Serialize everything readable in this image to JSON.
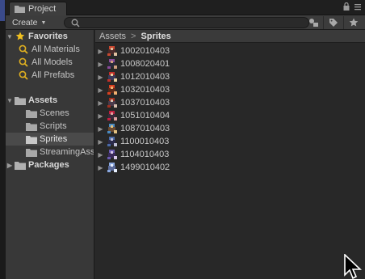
{
  "window": {
    "tab_title": "Project"
  },
  "toolbar": {
    "create_label": "Create",
    "search_placeholder": ""
  },
  "sidebar": {
    "favorites_label": "Favorites",
    "favorites": [
      "All Materials",
      "All Models",
      "All Prefabs"
    ],
    "assets_label": "Assets",
    "assets_children": [
      "Scenes",
      "Scripts",
      "Sprites",
      "StreamingAssets"
    ],
    "selected": "Sprites",
    "packages_label": "Packages"
  },
  "breadcrumb": {
    "root": "Assets",
    "current": "Sprites"
  },
  "files": [
    "1002010403",
    "1008020401",
    "1012010403",
    "1032010403",
    "1037010403",
    "1051010404",
    "1087010403",
    "1100010403",
    "1104010403",
    "1499010402"
  ],
  "colors": {
    "panel_bg": "#383838",
    "content_bg": "#282828",
    "selected_bg": "#4a4a4a",
    "text": "#c4c4c4",
    "favorite_star": "#f0c020"
  }
}
